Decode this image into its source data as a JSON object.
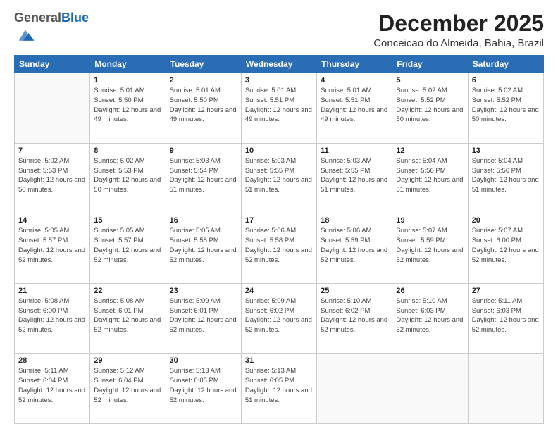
{
  "logo": {
    "general": "General",
    "blue": "Blue"
  },
  "header": {
    "title": "December 2025",
    "subtitle": "Conceicao do Almeida, Bahia, Brazil"
  },
  "weekdays": [
    "Sunday",
    "Monday",
    "Tuesday",
    "Wednesday",
    "Thursday",
    "Friday",
    "Saturday"
  ],
  "weeks": [
    [
      {
        "day": null
      },
      {
        "day": "1",
        "sunrise": "5:01 AM",
        "sunset": "5:50 PM",
        "daylight": "12 hours and 49 minutes."
      },
      {
        "day": "2",
        "sunrise": "5:01 AM",
        "sunset": "5:50 PM",
        "daylight": "12 hours and 49 minutes."
      },
      {
        "day": "3",
        "sunrise": "5:01 AM",
        "sunset": "5:51 PM",
        "daylight": "12 hours and 49 minutes."
      },
      {
        "day": "4",
        "sunrise": "5:01 AM",
        "sunset": "5:51 PM",
        "daylight": "12 hours and 49 minutes."
      },
      {
        "day": "5",
        "sunrise": "5:02 AM",
        "sunset": "5:52 PM",
        "daylight": "12 hours and 50 minutes."
      },
      {
        "day": "6",
        "sunrise": "5:02 AM",
        "sunset": "5:52 PM",
        "daylight": "12 hours and 50 minutes."
      }
    ],
    [
      {
        "day": "7",
        "sunrise": "5:02 AM",
        "sunset": "5:53 PM",
        "daylight": "12 hours and 50 minutes."
      },
      {
        "day": "8",
        "sunrise": "5:02 AM",
        "sunset": "5:53 PM",
        "daylight": "12 hours and 50 minutes."
      },
      {
        "day": "9",
        "sunrise": "5:03 AM",
        "sunset": "5:54 PM",
        "daylight": "12 hours and 51 minutes."
      },
      {
        "day": "10",
        "sunrise": "5:03 AM",
        "sunset": "5:55 PM",
        "daylight": "12 hours and 51 minutes."
      },
      {
        "day": "11",
        "sunrise": "5:03 AM",
        "sunset": "5:55 PM",
        "daylight": "12 hours and 51 minutes."
      },
      {
        "day": "12",
        "sunrise": "5:04 AM",
        "sunset": "5:56 PM",
        "daylight": "12 hours and 51 minutes."
      },
      {
        "day": "13",
        "sunrise": "5:04 AM",
        "sunset": "5:56 PM",
        "daylight": "12 hours and 51 minutes."
      }
    ],
    [
      {
        "day": "14",
        "sunrise": "5:05 AM",
        "sunset": "5:57 PM",
        "daylight": "12 hours and 52 minutes."
      },
      {
        "day": "15",
        "sunrise": "5:05 AM",
        "sunset": "5:57 PM",
        "daylight": "12 hours and 52 minutes."
      },
      {
        "day": "16",
        "sunrise": "5:05 AM",
        "sunset": "5:58 PM",
        "daylight": "12 hours and 52 minutes."
      },
      {
        "day": "17",
        "sunrise": "5:06 AM",
        "sunset": "5:58 PM",
        "daylight": "12 hours and 52 minutes."
      },
      {
        "day": "18",
        "sunrise": "5:06 AM",
        "sunset": "5:59 PM",
        "daylight": "12 hours and 52 minutes."
      },
      {
        "day": "19",
        "sunrise": "5:07 AM",
        "sunset": "5:59 PM",
        "daylight": "12 hours and 52 minutes."
      },
      {
        "day": "20",
        "sunrise": "5:07 AM",
        "sunset": "6:00 PM",
        "daylight": "12 hours and 52 minutes."
      }
    ],
    [
      {
        "day": "21",
        "sunrise": "5:08 AM",
        "sunset": "6:00 PM",
        "daylight": "12 hours and 52 minutes."
      },
      {
        "day": "22",
        "sunrise": "5:08 AM",
        "sunset": "6:01 PM",
        "daylight": "12 hours and 52 minutes."
      },
      {
        "day": "23",
        "sunrise": "5:09 AM",
        "sunset": "6:01 PM",
        "daylight": "12 hours and 52 minutes."
      },
      {
        "day": "24",
        "sunrise": "5:09 AM",
        "sunset": "6:02 PM",
        "daylight": "12 hours and 52 minutes."
      },
      {
        "day": "25",
        "sunrise": "5:10 AM",
        "sunset": "6:02 PM",
        "daylight": "12 hours and 52 minutes."
      },
      {
        "day": "26",
        "sunrise": "5:10 AM",
        "sunset": "6:03 PM",
        "daylight": "12 hours and 52 minutes."
      },
      {
        "day": "27",
        "sunrise": "5:11 AM",
        "sunset": "6:03 PM",
        "daylight": "12 hours and 52 minutes."
      }
    ],
    [
      {
        "day": "28",
        "sunrise": "5:11 AM",
        "sunset": "6:04 PM",
        "daylight": "12 hours and 52 minutes."
      },
      {
        "day": "29",
        "sunrise": "5:12 AM",
        "sunset": "6:04 PM",
        "daylight": "12 hours and 52 minutes."
      },
      {
        "day": "30",
        "sunrise": "5:13 AM",
        "sunset": "6:05 PM",
        "daylight": "12 hours and 52 minutes."
      },
      {
        "day": "31",
        "sunrise": "5:13 AM",
        "sunset": "6:05 PM",
        "daylight": "12 hours and 51 minutes."
      },
      {
        "day": null
      },
      {
        "day": null
      },
      {
        "day": null
      }
    ]
  ]
}
